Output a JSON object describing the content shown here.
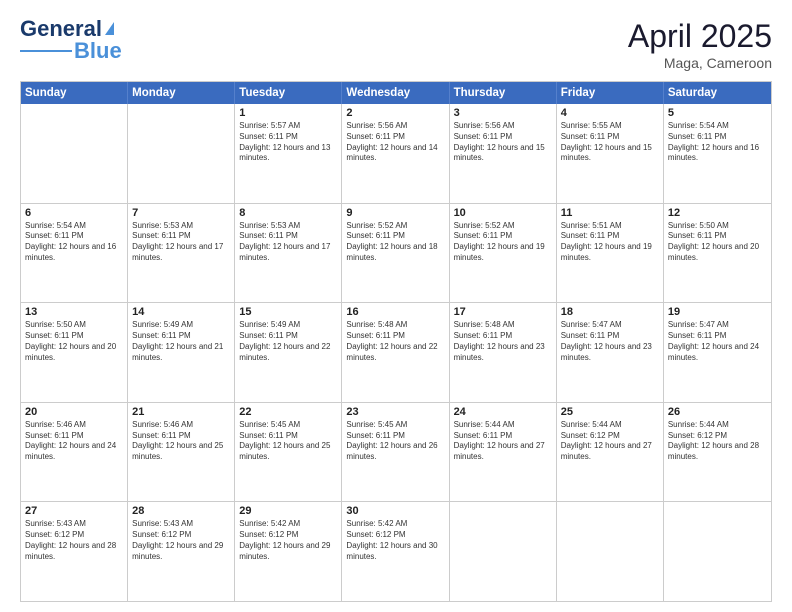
{
  "header": {
    "logo_general": "General",
    "logo_blue": "Blue",
    "title": "April 2025",
    "location": "Maga, Cameroon"
  },
  "days_of_week": [
    "Sunday",
    "Monday",
    "Tuesday",
    "Wednesday",
    "Thursday",
    "Friday",
    "Saturday"
  ],
  "weeks": [
    [
      {
        "day": "",
        "sunrise": "",
        "sunset": "",
        "daylight": ""
      },
      {
        "day": "",
        "sunrise": "",
        "sunset": "",
        "daylight": ""
      },
      {
        "day": "1",
        "sunrise": "Sunrise: 5:57 AM",
        "sunset": "Sunset: 6:11 PM",
        "daylight": "Daylight: 12 hours and 13 minutes."
      },
      {
        "day": "2",
        "sunrise": "Sunrise: 5:56 AM",
        "sunset": "Sunset: 6:11 PM",
        "daylight": "Daylight: 12 hours and 14 minutes."
      },
      {
        "day": "3",
        "sunrise": "Sunrise: 5:56 AM",
        "sunset": "Sunset: 6:11 PM",
        "daylight": "Daylight: 12 hours and 15 minutes."
      },
      {
        "day": "4",
        "sunrise": "Sunrise: 5:55 AM",
        "sunset": "Sunset: 6:11 PM",
        "daylight": "Daylight: 12 hours and 15 minutes."
      },
      {
        "day": "5",
        "sunrise": "Sunrise: 5:54 AM",
        "sunset": "Sunset: 6:11 PM",
        "daylight": "Daylight: 12 hours and 16 minutes."
      }
    ],
    [
      {
        "day": "6",
        "sunrise": "Sunrise: 5:54 AM",
        "sunset": "Sunset: 6:11 PM",
        "daylight": "Daylight: 12 hours and 16 minutes."
      },
      {
        "day": "7",
        "sunrise": "Sunrise: 5:53 AM",
        "sunset": "Sunset: 6:11 PM",
        "daylight": "Daylight: 12 hours and 17 minutes."
      },
      {
        "day": "8",
        "sunrise": "Sunrise: 5:53 AM",
        "sunset": "Sunset: 6:11 PM",
        "daylight": "Daylight: 12 hours and 17 minutes."
      },
      {
        "day": "9",
        "sunrise": "Sunrise: 5:52 AM",
        "sunset": "Sunset: 6:11 PM",
        "daylight": "Daylight: 12 hours and 18 minutes."
      },
      {
        "day": "10",
        "sunrise": "Sunrise: 5:52 AM",
        "sunset": "Sunset: 6:11 PM",
        "daylight": "Daylight: 12 hours and 19 minutes."
      },
      {
        "day": "11",
        "sunrise": "Sunrise: 5:51 AM",
        "sunset": "Sunset: 6:11 PM",
        "daylight": "Daylight: 12 hours and 19 minutes."
      },
      {
        "day": "12",
        "sunrise": "Sunrise: 5:50 AM",
        "sunset": "Sunset: 6:11 PM",
        "daylight": "Daylight: 12 hours and 20 minutes."
      }
    ],
    [
      {
        "day": "13",
        "sunrise": "Sunrise: 5:50 AM",
        "sunset": "Sunset: 6:11 PM",
        "daylight": "Daylight: 12 hours and 20 minutes."
      },
      {
        "day": "14",
        "sunrise": "Sunrise: 5:49 AM",
        "sunset": "Sunset: 6:11 PM",
        "daylight": "Daylight: 12 hours and 21 minutes."
      },
      {
        "day": "15",
        "sunrise": "Sunrise: 5:49 AM",
        "sunset": "Sunset: 6:11 PM",
        "daylight": "Daylight: 12 hours and 22 minutes."
      },
      {
        "day": "16",
        "sunrise": "Sunrise: 5:48 AM",
        "sunset": "Sunset: 6:11 PM",
        "daylight": "Daylight: 12 hours and 22 minutes."
      },
      {
        "day": "17",
        "sunrise": "Sunrise: 5:48 AM",
        "sunset": "Sunset: 6:11 PM",
        "daylight": "Daylight: 12 hours and 23 minutes."
      },
      {
        "day": "18",
        "sunrise": "Sunrise: 5:47 AM",
        "sunset": "Sunset: 6:11 PM",
        "daylight": "Daylight: 12 hours and 23 minutes."
      },
      {
        "day": "19",
        "sunrise": "Sunrise: 5:47 AM",
        "sunset": "Sunset: 6:11 PM",
        "daylight": "Daylight: 12 hours and 24 minutes."
      }
    ],
    [
      {
        "day": "20",
        "sunrise": "Sunrise: 5:46 AM",
        "sunset": "Sunset: 6:11 PM",
        "daylight": "Daylight: 12 hours and 24 minutes."
      },
      {
        "day": "21",
        "sunrise": "Sunrise: 5:46 AM",
        "sunset": "Sunset: 6:11 PM",
        "daylight": "Daylight: 12 hours and 25 minutes."
      },
      {
        "day": "22",
        "sunrise": "Sunrise: 5:45 AM",
        "sunset": "Sunset: 6:11 PM",
        "daylight": "Daylight: 12 hours and 25 minutes."
      },
      {
        "day": "23",
        "sunrise": "Sunrise: 5:45 AM",
        "sunset": "Sunset: 6:11 PM",
        "daylight": "Daylight: 12 hours and 26 minutes."
      },
      {
        "day": "24",
        "sunrise": "Sunrise: 5:44 AM",
        "sunset": "Sunset: 6:11 PM",
        "daylight": "Daylight: 12 hours and 27 minutes."
      },
      {
        "day": "25",
        "sunrise": "Sunrise: 5:44 AM",
        "sunset": "Sunset: 6:12 PM",
        "daylight": "Daylight: 12 hours and 27 minutes."
      },
      {
        "day": "26",
        "sunrise": "Sunrise: 5:44 AM",
        "sunset": "Sunset: 6:12 PM",
        "daylight": "Daylight: 12 hours and 28 minutes."
      }
    ],
    [
      {
        "day": "27",
        "sunrise": "Sunrise: 5:43 AM",
        "sunset": "Sunset: 6:12 PM",
        "daylight": "Daylight: 12 hours and 28 minutes."
      },
      {
        "day": "28",
        "sunrise": "Sunrise: 5:43 AM",
        "sunset": "Sunset: 6:12 PM",
        "daylight": "Daylight: 12 hours and 29 minutes."
      },
      {
        "day": "29",
        "sunrise": "Sunrise: 5:42 AM",
        "sunset": "Sunset: 6:12 PM",
        "daylight": "Daylight: 12 hours and 29 minutes."
      },
      {
        "day": "30",
        "sunrise": "Sunrise: 5:42 AM",
        "sunset": "Sunset: 6:12 PM",
        "daylight": "Daylight: 12 hours and 30 minutes."
      },
      {
        "day": "",
        "sunrise": "",
        "sunset": "",
        "daylight": ""
      },
      {
        "day": "",
        "sunrise": "",
        "sunset": "",
        "daylight": ""
      },
      {
        "day": "",
        "sunrise": "",
        "sunset": "",
        "daylight": ""
      }
    ]
  ]
}
